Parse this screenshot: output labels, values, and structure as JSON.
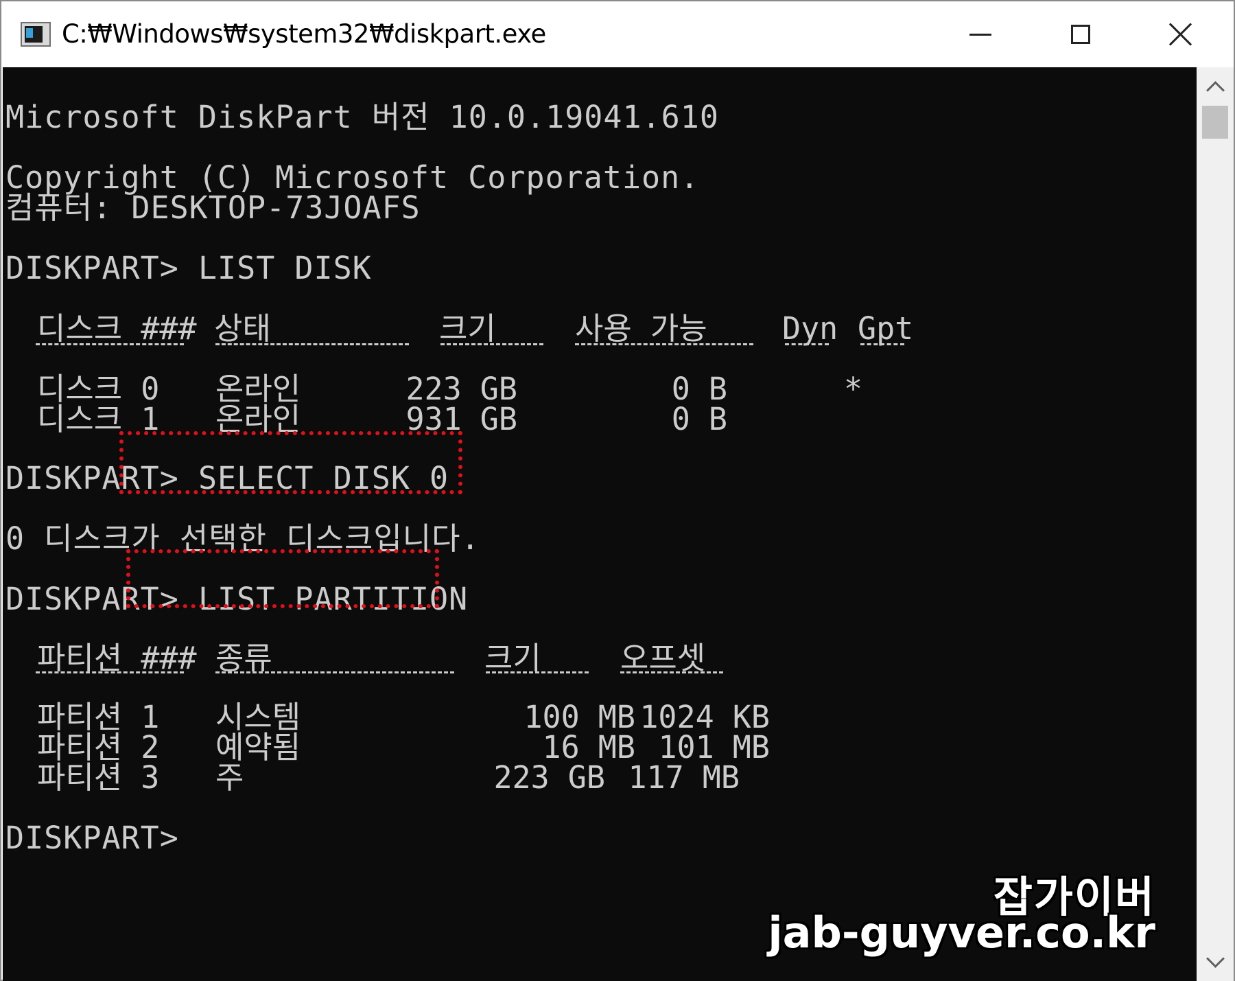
{
  "window": {
    "title": "C:₩Windows₩system32₩diskpart.exe"
  },
  "console": {
    "banner": "Microsoft DiskPart 버전 10.0.19041.610",
    "copyright": "Copyright (C) Microsoft Corporation.",
    "computer": "컴퓨터: DESKTOP-73JOAFS",
    "prompt_label": "DISKPART>",
    "cmd_list_disk": "LIST DISK",
    "cmd_select_disk": "SELECT DISK 0",
    "select_result": "0 디스크가 선택한 디스크입니다.",
    "cmd_list_partition": "LIST PARTITION",
    "disk_table": {
      "headers": [
        "디스크 ###",
        "상태",
        "크기",
        "사용 가능",
        "Dyn",
        "Gpt"
      ],
      "rows": [
        {
          "disk": "디스크 0",
          "status": "온라인",
          "size": "223 GB",
          "free": "0 B",
          "dyn": "",
          "gpt": "*"
        },
        {
          "disk": "디스크 1",
          "status": "온라인",
          "size": "931 GB",
          "free": "0 B",
          "dyn": "",
          "gpt": ""
        }
      ]
    },
    "partition_table": {
      "headers": [
        "파티션 ###",
        "종류",
        "크기",
        "오프셋"
      ],
      "rows": [
        {
          "partition": "파티션 1",
          "type": "시스템",
          "size": "100 MB",
          "offset": "1024 KB"
        },
        {
          "partition": "파티션 2",
          "type": "예약됨",
          "size": "16 MB",
          "offset": "101 MB"
        },
        {
          "partition": "파티션 3",
          "type": "주",
          "size": "223 GB",
          "offset": "117 MB"
        }
      ]
    }
  },
  "watermark": {
    "name": "잡가이버",
    "url": "jab-guyver.co.kr"
  },
  "colors": {
    "console_bg": "#0c0c0c",
    "console_text": "#cccccc",
    "highlight": "#e0101a"
  },
  "icons": {
    "app": "console-app-icon",
    "minimize": "minimize-icon",
    "maximize": "maximize-icon",
    "close": "close-icon"
  }
}
